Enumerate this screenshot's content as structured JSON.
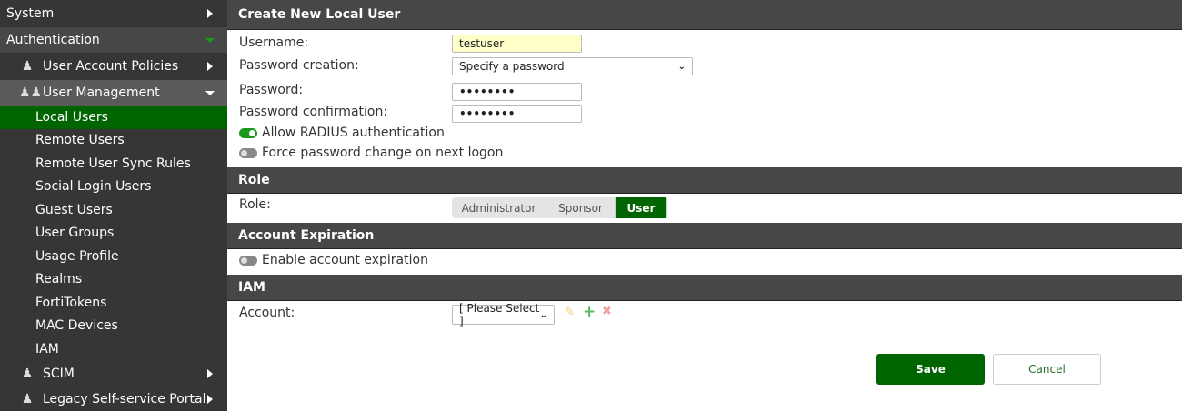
{
  "sidebar": {
    "system": "System",
    "authentication": "Authentication",
    "user_account_policies": "User Account Policies",
    "user_management": "User Management",
    "items": [
      "Local Users",
      "Remote Users",
      "Remote User Sync Rules",
      "Social Login Users",
      "Guest Users",
      "User Groups",
      "Usage Profile",
      "Realms",
      "FortiTokens",
      "MAC Devices",
      "IAM"
    ],
    "scim": "SCIM",
    "legacy": "Legacy Self-service Portal"
  },
  "form": {
    "title": "Create New Local User",
    "username_label": "Username:",
    "username_value": "testuser",
    "pwcreation_label": "Password creation:",
    "pwcreation_value": "Specify a password",
    "password_label": "Password:",
    "password_value": "••••••••",
    "confirm_label": "Password confirmation:",
    "confirm_value": "••••••••",
    "radius_label": "Allow RADIUS authentication",
    "force_label": "Force password change on next logon",
    "role_section": "Role",
    "role_label": "Role:",
    "roles": [
      "Administrator",
      "Sponsor",
      "User"
    ],
    "expiration_section": "Account Expiration",
    "expiration_label": "Enable account expiration",
    "iam_section": "IAM",
    "account_label": "Account:",
    "account_value": "[ Please Select ]",
    "save": "Save",
    "cancel": "Cancel"
  },
  "colors": {
    "accent": "#006400"
  }
}
